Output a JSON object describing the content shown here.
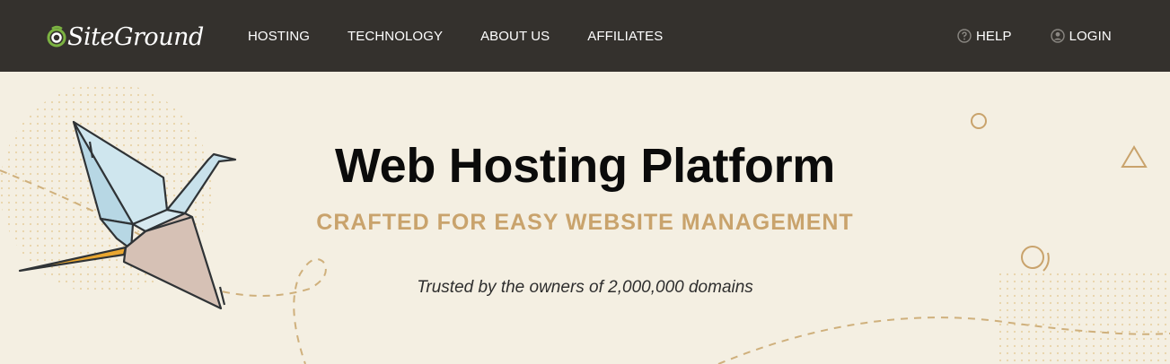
{
  "header": {
    "logo_text": "SiteGround",
    "nav": [
      {
        "label": "HOSTING"
      },
      {
        "label": "TECHNOLOGY"
      },
      {
        "label": "ABOUT US"
      },
      {
        "label": "AFFILIATES"
      }
    ],
    "help": {
      "label": "HELP",
      "icon": "question-circle-icon"
    },
    "login": {
      "label": "LOGIN",
      "icon": "user-circle-icon"
    }
  },
  "hero": {
    "title": "Web Hosting Platform",
    "subtitle": "CRAFTED FOR EASY WEBSITE MANAGEMENT",
    "trust_line": "Trusted by the owners of 2,000,000 domains"
  },
  "colors": {
    "header_bg": "#34312d",
    "hero_bg": "#f4efe2",
    "accent_gold": "#c9a36c",
    "logo_green": "#7cb342"
  }
}
